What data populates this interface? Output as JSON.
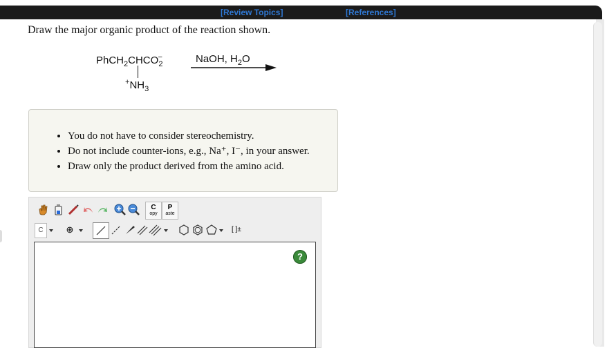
{
  "topbar": {
    "review_topics": "[Review Topics]",
    "references": "[References]"
  },
  "question": {
    "prompt": "Draw the major organic product of the reaction shown."
  },
  "reaction": {
    "reactant_main": "PhCH",
    "reactant_2": "2",
    "reactant_chco": "CHCO",
    "reactant_o_sub": "2",
    "reactant_minus": "−",
    "substituent_plus": "+",
    "substituent": "NH",
    "substituent_sub": "3",
    "reagent_main": "NaOH, H",
    "reagent_sub": "2",
    "reagent_end": "O"
  },
  "notes": {
    "items": [
      "You do not have to consider stereochemistry.",
      "Do not include counter-ions, e.g., Na⁺, I⁻, in your answer.",
      "Draw only the product derived from the amino acid."
    ]
  },
  "toolbar": {
    "copy_label_c": "C",
    "copy_label": "opy",
    "paste_label_p": "P",
    "paste_label": "aste",
    "element_label": "C",
    "charge_label": "⊕",
    "bracket_label": "[ ]±"
  },
  "help": {
    "label": "?"
  }
}
